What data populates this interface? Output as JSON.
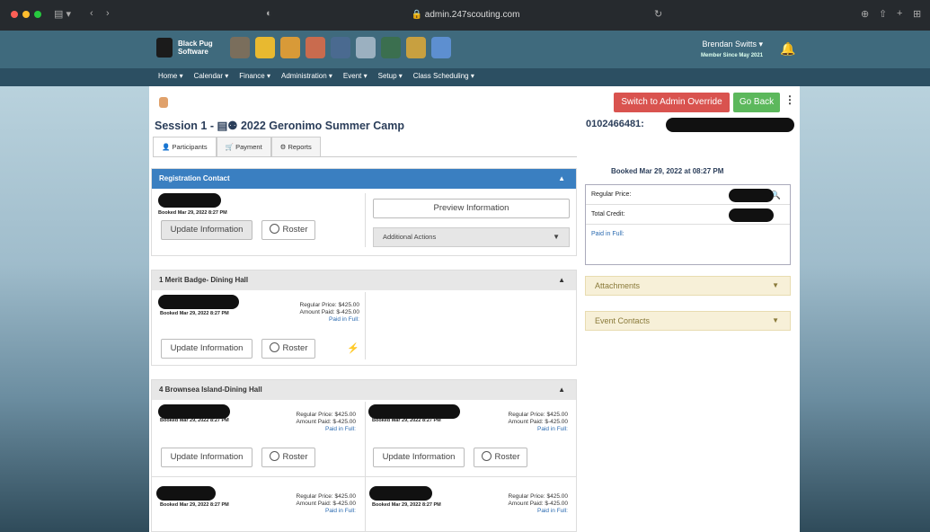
{
  "browser": {
    "url": "admin.247scouting.com"
  },
  "brand": {
    "line1": "Black Pug",
    "line2": "Software"
  },
  "user": {
    "name": "Brendan Switts ▾",
    "member_since": "Member Since  May 2021"
  },
  "nav": [
    "Home ▾",
    "Calendar ▾",
    "Finance ▾",
    "Administration ▾",
    "Event ▾",
    "Setup ▾",
    "Class Scheduling ▾"
  ],
  "buttons": {
    "admin_override": "Switch to Admin Override",
    "go_back": "Go Back"
  },
  "session_title": "Session 1 - ▤⚉ 2022 Geronimo Summer Camp",
  "registration_id": "0102466481:",
  "tabs": [
    "Participants",
    "Payment",
    "Reports"
  ],
  "registration_contact": {
    "header": "Registration Contact",
    "booked": "Booked Mar 29, 2022 8:27 PM",
    "update": "Update Information",
    "roster": "Roster",
    "preview": "Preview Information",
    "actions": "Additional Actions"
  },
  "groups": [
    {
      "header": "1 Merit Badge- Dining Hall"
    },
    {
      "header": "4 Brownsea Island-Dining Hall"
    }
  ],
  "participant": {
    "booked": "Booked Mar 29, 2022 8:27 PM",
    "regular": "Regular Price:  $425.00",
    "paid": "Amount Paid:  $-425.00",
    "pif": "Paid in Full:",
    "update": "Update Information",
    "roster": "Roster"
  },
  "summary": {
    "title": "Booked Mar 29, 2022 at 08:27 PM",
    "regular": "Regular Price:",
    "credit": "Total Credit:",
    "pif": "Paid in Full:"
  },
  "side_panels": {
    "attachments": "Attachments",
    "contacts": "Event Contacts"
  },
  "colors": {
    "topbar": "#3f6a7d",
    "navbar": "#2c4f62",
    "blue_header": "#3a7fc1",
    "danger": "#d9534f",
    "success": "#5cb85c"
  }
}
